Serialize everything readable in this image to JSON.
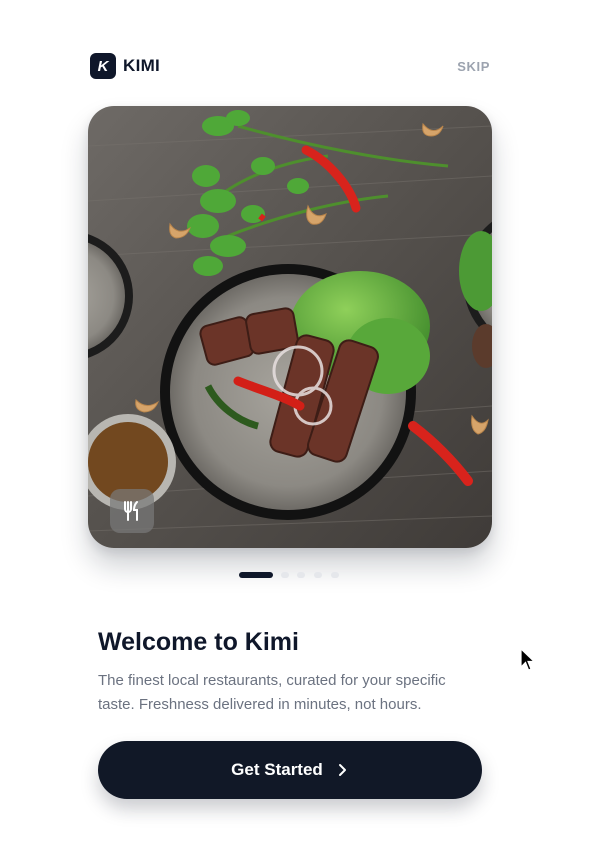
{
  "header": {
    "logo_letter": "K",
    "brand": "KIMI",
    "skip_label": "SKIP"
  },
  "hero": {
    "image_description_icon": "salad-bowl-photo",
    "badge_icon": "fork-knife-icon"
  },
  "pagination": {
    "total": 5,
    "active_index": 0
  },
  "content": {
    "title": "Welcome to Kimi",
    "description_line1": "The finest local restaurants, curated for your specific",
    "description_line2": "taste. Freshness delivered in minutes, not hours."
  },
  "cta": {
    "label": "Get Started",
    "icon": "chevron-right-icon"
  },
  "colors": {
    "primary": "#0f172a",
    "button": "#111827",
    "muted_text": "#6b7280",
    "skip_text": "#9ca3af",
    "dot_inactive": "#e5e7eb"
  }
}
